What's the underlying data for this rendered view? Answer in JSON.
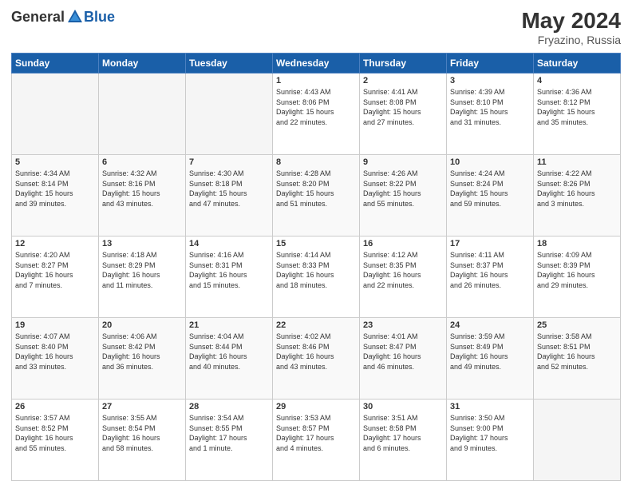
{
  "header": {
    "logo_general": "General",
    "logo_blue": "Blue",
    "month_year": "May 2024",
    "location": "Fryazino, Russia"
  },
  "weekdays": [
    "Sunday",
    "Monday",
    "Tuesday",
    "Wednesday",
    "Thursday",
    "Friday",
    "Saturday"
  ],
  "weeks": [
    [
      {
        "day": "",
        "info": ""
      },
      {
        "day": "",
        "info": ""
      },
      {
        "day": "",
        "info": ""
      },
      {
        "day": "1",
        "info": "Sunrise: 4:43 AM\nSunset: 8:06 PM\nDaylight: 15 hours\nand 22 minutes."
      },
      {
        "day": "2",
        "info": "Sunrise: 4:41 AM\nSunset: 8:08 PM\nDaylight: 15 hours\nand 27 minutes."
      },
      {
        "day": "3",
        "info": "Sunrise: 4:39 AM\nSunset: 8:10 PM\nDaylight: 15 hours\nand 31 minutes."
      },
      {
        "day": "4",
        "info": "Sunrise: 4:36 AM\nSunset: 8:12 PM\nDaylight: 15 hours\nand 35 minutes."
      }
    ],
    [
      {
        "day": "5",
        "info": "Sunrise: 4:34 AM\nSunset: 8:14 PM\nDaylight: 15 hours\nand 39 minutes."
      },
      {
        "day": "6",
        "info": "Sunrise: 4:32 AM\nSunset: 8:16 PM\nDaylight: 15 hours\nand 43 minutes."
      },
      {
        "day": "7",
        "info": "Sunrise: 4:30 AM\nSunset: 8:18 PM\nDaylight: 15 hours\nand 47 minutes."
      },
      {
        "day": "8",
        "info": "Sunrise: 4:28 AM\nSunset: 8:20 PM\nDaylight: 15 hours\nand 51 minutes."
      },
      {
        "day": "9",
        "info": "Sunrise: 4:26 AM\nSunset: 8:22 PM\nDaylight: 15 hours\nand 55 minutes."
      },
      {
        "day": "10",
        "info": "Sunrise: 4:24 AM\nSunset: 8:24 PM\nDaylight: 15 hours\nand 59 minutes."
      },
      {
        "day": "11",
        "info": "Sunrise: 4:22 AM\nSunset: 8:26 PM\nDaylight: 16 hours\nand 3 minutes."
      }
    ],
    [
      {
        "day": "12",
        "info": "Sunrise: 4:20 AM\nSunset: 8:27 PM\nDaylight: 16 hours\nand 7 minutes."
      },
      {
        "day": "13",
        "info": "Sunrise: 4:18 AM\nSunset: 8:29 PM\nDaylight: 16 hours\nand 11 minutes."
      },
      {
        "day": "14",
        "info": "Sunrise: 4:16 AM\nSunset: 8:31 PM\nDaylight: 16 hours\nand 15 minutes."
      },
      {
        "day": "15",
        "info": "Sunrise: 4:14 AM\nSunset: 8:33 PM\nDaylight: 16 hours\nand 18 minutes."
      },
      {
        "day": "16",
        "info": "Sunrise: 4:12 AM\nSunset: 8:35 PM\nDaylight: 16 hours\nand 22 minutes."
      },
      {
        "day": "17",
        "info": "Sunrise: 4:11 AM\nSunset: 8:37 PM\nDaylight: 16 hours\nand 26 minutes."
      },
      {
        "day": "18",
        "info": "Sunrise: 4:09 AM\nSunset: 8:39 PM\nDaylight: 16 hours\nand 29 minutes."
      }
    ],
    [
      {
        "day": "19",
        "info": "Sunrise: 4:07 AM\nSunset: 8:40 PM\nDaylight: 16 hours\nand 33 minutes."
      },
      {
        "day": "20",
        "info": "Sunrise: 4:06 AM\nSunset: 8:42 PM\nDaylight: 16 hours\nand 36 minutes."
      },
      {
        "day": "21",
        "info": "Sunrise: 4:04 AM\nSunset: 8:44 PM\nDaylight: 16 hours\nand 40 minutes."
      },
      {
        "day": "22",
        "info": "Sunrise: 4:02 AM\nSunset: 8:46 PM\nDaylight: 16 hours\nand 43 minutes."
      },
      {
        "day": "23",
        "info": "Sunrise: 4:01 AM\nSunset: 8:47 PM\nDaylight: 16 hours\nand 46 minutes."
      },
      {
        "day": "24",
        "info": "Sunrise: 3:59 AM\nSunset: 8:49 PM\nDaylight: 16 hours\nand 49 minutes."
      },
      {
        "day": "25",
        "info": "Sunrise: 3:58 AM\nSunset: 8:51 PM\nDaylight: 16 hours\nand 52 minutes."
      }
    ],
    [
      {
        "day": "26",
        "info": "Sunrise: 3:57 AM\nSunset: 8:52 PM\nDaylight: 16 hours\nand 55 minutes."
      },
      {
        "day": "27",
        "info": "Sunrise: 3:55 AM\nSunset: 8:54 PM\nDaylight: 16 hours\nand 58 minutes."
      },
      {
        "day": "28",
        "info": "Sunrise: 3:54 AM\nSunset: 8:55 PM\nDaylight: 17 hours\nand 1 minute."
      },
      {
        "day": "29",
        "info": "Sunrise: 3:53 AM\nSunset: 8:57 PM\nDaylight: 17 hours\nand 4 minutes."
      },
      {
        "day": "30",
        "info": "Sunrise: 3:51 AM\nSunset: 8:58 PM\nDaylight: 17 hours\nand 6 minutes."
      },
      {
        "day": "31",
        "info": "Sunrise: 3:50 AM\nSunset: 9:00 PM\nDaylight: 17 hours\nand 9 minutes."
      },
      {
        "day": "",
        "info": ""
      }
    ]
  ]
}
